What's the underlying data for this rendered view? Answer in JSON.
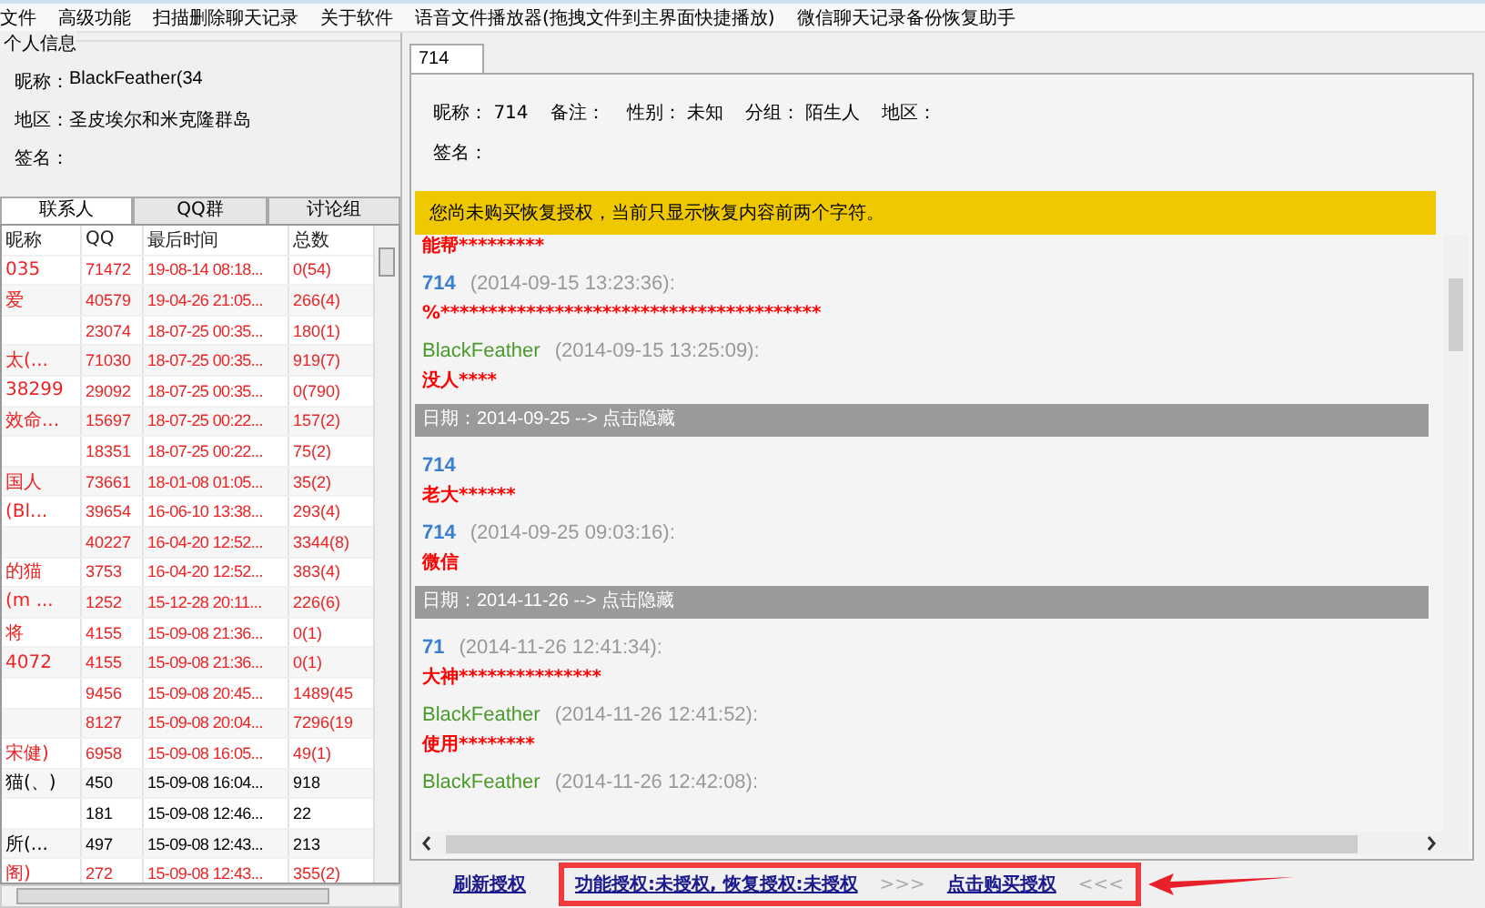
{
  "menu": [
    "文件",
    "高级功能",
    "扫描删除聊天记录",
    "关于软件",
    "语音文件播放器(拖拽文件到主界面快捷播放)",
    "微信聊天记录备份恢复助手"
  ],
  "profile": {
    "title": "个人信息",
    "fields": [
      {
        "label": "昵称：",
        "value": "BlackFeather(34"
      },
      {
        "label": "地区：",
        "value": "圣皮埃尔和米克隆群岛"
      },
      {
        "label": "签名："
      }
    ]
  },
  "contact_tabs": [
    {
      "label": "联系人",
      "selected": true
    },
    {
      "label": "QQ群",
      "selected": false
    },
    {
      "label": "讨论组",
      "selected": false
    }
  ],
  "table": {
    "columns": [
      "昵称",
      "QQ",
      "最后时间",
      "总数"
    ],
    "rows": [
      {
        "name": "035",
        "qq": "71472",
        "time": "19-08-14 08:18...",
        "total": "0(54)",
        "recovered": true
      },
      {
        "name": "爱",
        "qq": "40579",
        "time": "19-04-26 21:05...",
        "total": "266(4)",
        "recovered": true
      },
      {
        "qq": "23074",
        "time": "18-07-25 00:35...",
        "total": "180(1)",
        "recovered": true
      },
      {
        "name": "太(...",
        "qq": "71030",
        "time": "18-07-25 00:35...",
        "total": "919(7)",
        "recovered": true
      },
      {
        "name": "38299",
        "qq": "29092",
        "time": "18-07-25 00:35...",
        "total": "0(790)",
        "recovered": true
      },
      {
        "name": "效命...",
        "qq": "15697",
        "time": "18-07-25 00:22...",
        "total": "157(2)",
        "recovered": true
      },
      {
        "qq": "18351",
        "time": "18-07-25 00:22...",
        "total": "75(2)",
        "recovered": true
      },
      {
        "name": "国人",
        "qq": "73661",
        "time": "18-01-08 01:05...",
        "total": "35(2)",
        "recovered": true
      },
      {
        "name": "(Bl...",
        "qq": "39654",
        "time": "16-06-10 13:38...",
        "total": "293(4)",
        "recovered": true
      },
      {
        "qq": "40227",
        "time": "16-04-20 12:52...",
        "total": "3344(8)",
        "recovered": true
      },
      {
        "name": "的猫",
        "qq": "3753",
        "time": "16-04-20 12:52...",
        "total": "383(4)",
        "recovered": true
      },
      {
        "name": "(m ...",
        "qq": "1252",
        "time": "15-12-28 20:11...",
        "total": "226(6)",
        "recovered": true
      },
      {
        "name": "将",
        "qq": "4155",
        "time": "15-09-08 21:36...",
        "total": "0(1)",
        "recovered": true
      },
      {
        "name": "4072",
        "qq": "4155",
        "time": "15-09-08 21:36...",
        "total": "0(1)",
        "recovered": true
      },
      {
        "qq": "9456",
        "time": "15-09-08 20:45...",
        "total": "1489(45",
        "recovered": true
      },
      {
        "qq": "8127",
        "time": "15-09-08 20:04...",
        "total": "7296(19",
        "recovered": true
      },
      {
        "name": "宋健)",
        "qq": "6958",
        "time": "15-09-08 16:05...",
        "total": "49(1)",
        "recovered": true
      },
      {
        "name": "猫(、)",
        "qq": "450",
        "time": "15-09-08 16:04...",
        "total": "918",
        "recovered": false
      },
      {
        "qq": "181",
        "time": "15-09-08 12:46...",
        "total": "22",
        "recovered": false
      },
      {
        "name": "所(...",
        "qq": "497",
        "time": "15-09-08 12:43...",
        "total": "213",
        "recovered": false
      },
      {
        "name": "阁)",
        "qq": "272",
        "time": "15-09-08 12:43...",
        "total": "355(2)",
        "recovered": true
      }
    ]
  },
  "chat_tab": {
    "label": "714",
    "selected": true
  },
  "contact_info": [
    {
      "label": "昵称：",
      "value": "714"
    },
    {
      "label": "备注："
    },
    {
      "label": "性别：",
      "value": "未知"
    },
    {
      "label": "分组：",
      "value": "陌生人"
    },
    {
      "label": "地区："
    }
  ],
  "signature_label": "签名：",
  "notice": "您尚未购买恢复授权，当前只显示恢复内容前两个字符。",
  "messages": [
    {
      "kind": "text",
      "text": "能帮*********"
    },
    {
      "kind": "header",
      "sender": "714",
      "own": false,
      "time": "(2014-09-15 13:23:36):"
    },
    {
      "kind": "text",
      "text": "%****************************************"
    },
    {
      "kind": "header",
      "sender": "BlackFeather",
      "own": true,
      "time": "(2014-09-15 13:25:09):"
    },
    {
      "kind": "text",
      "text": "没人****"
    },
    {
      "kind": "date",
      "text": "日期：2014-09-25  --> 点击隐藏"
    },
    {
      "kind": "header",
      "sender": "714",
      "own": false
    },
    {
      "kind": "text",
      "text": "老大******"
    },
    {
      "kind": "header",
      "sender": "714",
      "own": false,
      "time": "(2014-09-25 09:03:16):"
    },
    {
      "kind": "text",
      "text": "微信"
    },
    {
      "kind": "date",
      "text": "日期：2014-11-26  --> 点击隐藏"
    },
    {
      "kind": "header",
      "sender": "71",
      "own": false,
      "time": "(2014-11-26 12:41:34):"
    },
    {
      "kind": "text",
      "text": "大神***************"
    },
    {
      "kind": "header",
      "sender": "BlackFeather",
      "own": true,
      "time": "(2014-11-26 12:41:52):"
    },
    {
      "kind": "text",
      "text": "使用********"
    },
    {
      "kind": "header",
      "sender": "BlackFeather",
      "own": true,
      "time": "(2014-11-26 12:42:08):"
    }
  ],
  "footer": {
    "refresh_link": "刷新授权",
    "status_link": "功能授权:未授权, 恢复授权:未授权",
    "open_marks": ">>>",
    "buy_link": "点击购买授权",
    "close_marks": "<<<"
  }
}
